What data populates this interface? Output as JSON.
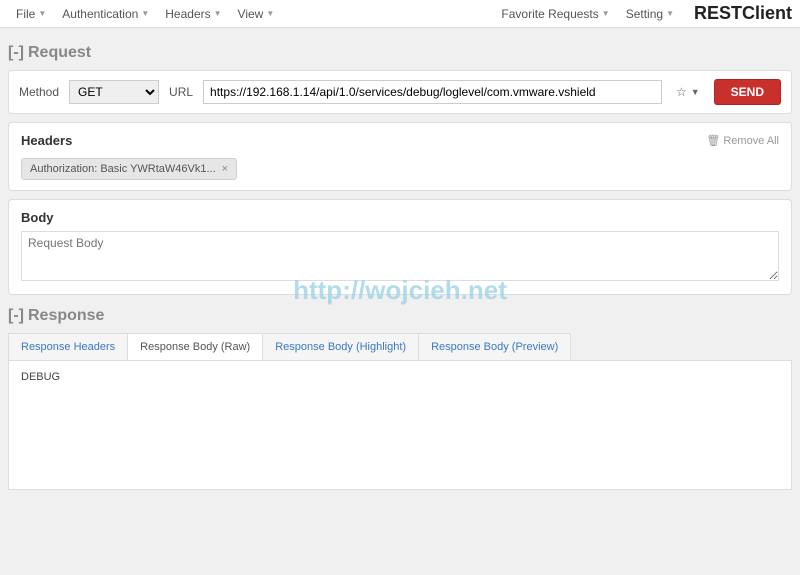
{
  "menubar": {
    "left": [
      "File",
      "Authentication",
      "Headers",
      "View"
    ],
    "right": [
      "Favorite Requests",
      "Setting"
    ]
  },
  "app_title": "RESTClient",
  "request": {
    "section_label": "Request",
    "collapse": "[-]",
    "method_label": "Method",
    "method_value": "GET",
    "url_label": "URL",
    "url_value": "https://192.168.1.14/api/1.0/services/debug/loglevel/com.vmware.vshield",
    "send_label": "SEND"
  },
  "headers": {
    "title": "Headers",
    "remove_all": "Remove All",
    "chip_text": "Authorization: Basic YWRtaW46Vk1...",
    "chip_close": "×"
  },
  "body": {
    "title": "Body",
    "placeholder": "Request Body"
  },
  "watermark": "http://wojcieh.net",
  "response": {
    "section_label": "Response",
    "collapse": "[-]",
    "tabs": [
      "Response Headers",
      "Response Body (Raw)",
      "Response Body (Highlight)",
      "Response Body (Preview)"
    ],
    "active_tab_index": 1,
    "body_raw": "DEBUG"
  }
}
